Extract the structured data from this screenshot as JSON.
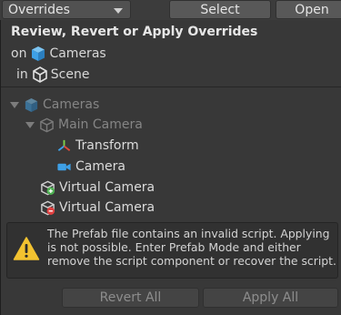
{
  "toolbar": {
    "overrides_label": "Overrides",
    "select_label": "Select",
    "open_label": "Open"
  },
  "panel": {
    "title": "Review, Revert or Apply Overrides",
    "on_prefix": "on",
    "on_value": "Cameras",
    "in_prefix": "in",
    "in_value": "Scene"
  },
  "tree": {
    "root": "Cameras",
    "child": "Main Camera",
    "components": [
      "Transform",
      "Camera"
    ],
    "virtual_cameras": [
      "Virtual Camera",
      "Virtual Camera"
    ]
  },
  "warning": {
    "message": "The Prefab file contains an invalid script. Applying is not possible. Enter Prefab Mode and either remove the script component or recover the script."
  },
  "buttons": {
    "revert_all": "Revert All",
    "apply_all": "Apply All"
  },
  "colors": {
    "background": "#383838",
    "prefab_blue": "#3ea0e6",
    "added_green": "#4caf50",
    "removed_red": "#e04040",
    "warning_yellow": "#f2c230"
  }
}
